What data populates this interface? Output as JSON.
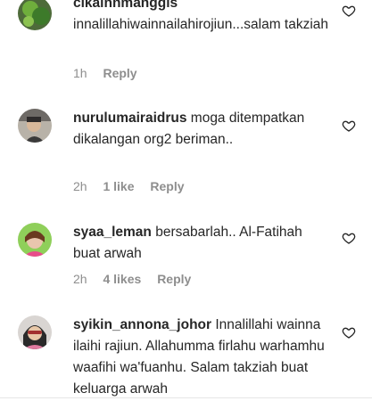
{
  "comments": [
    {
      "username": "cikainnmanggis",
      "text": "innalillahiwainnailahirojiun...salam takziah",
      "time": "1h",
      "likes": "",
      "reply_label": "Reply"
    },
    {
      "username": "nurulumairaidrus",
      "text": "moga ditempatkan dikalangan org2 beriman..",
      "time": "2h",
      "likes": "1 like",
      "reply_label": "Reply"
    },
    {
      "username": "syaa_leman",
      "text": "bersabarlah.. Al-Fatihah buat arwah",
      "time": "2h",
      "likes": "4 likes",
      "reply_label": "Reply"
    },
    {
      "username": "syikin_annona_johor",
      "text": "Innalillahi wainna ilaihi rajiun. Allahumma firlahu warhamhu waafihi wa'fuanhu. Salam takziah buat keluarga arwah",
      "time": "",
      "likes": "",
      "reply_label": ""
    }
  ],
  "icons": {
    "like": "heart-outline-icon"
  }
}
